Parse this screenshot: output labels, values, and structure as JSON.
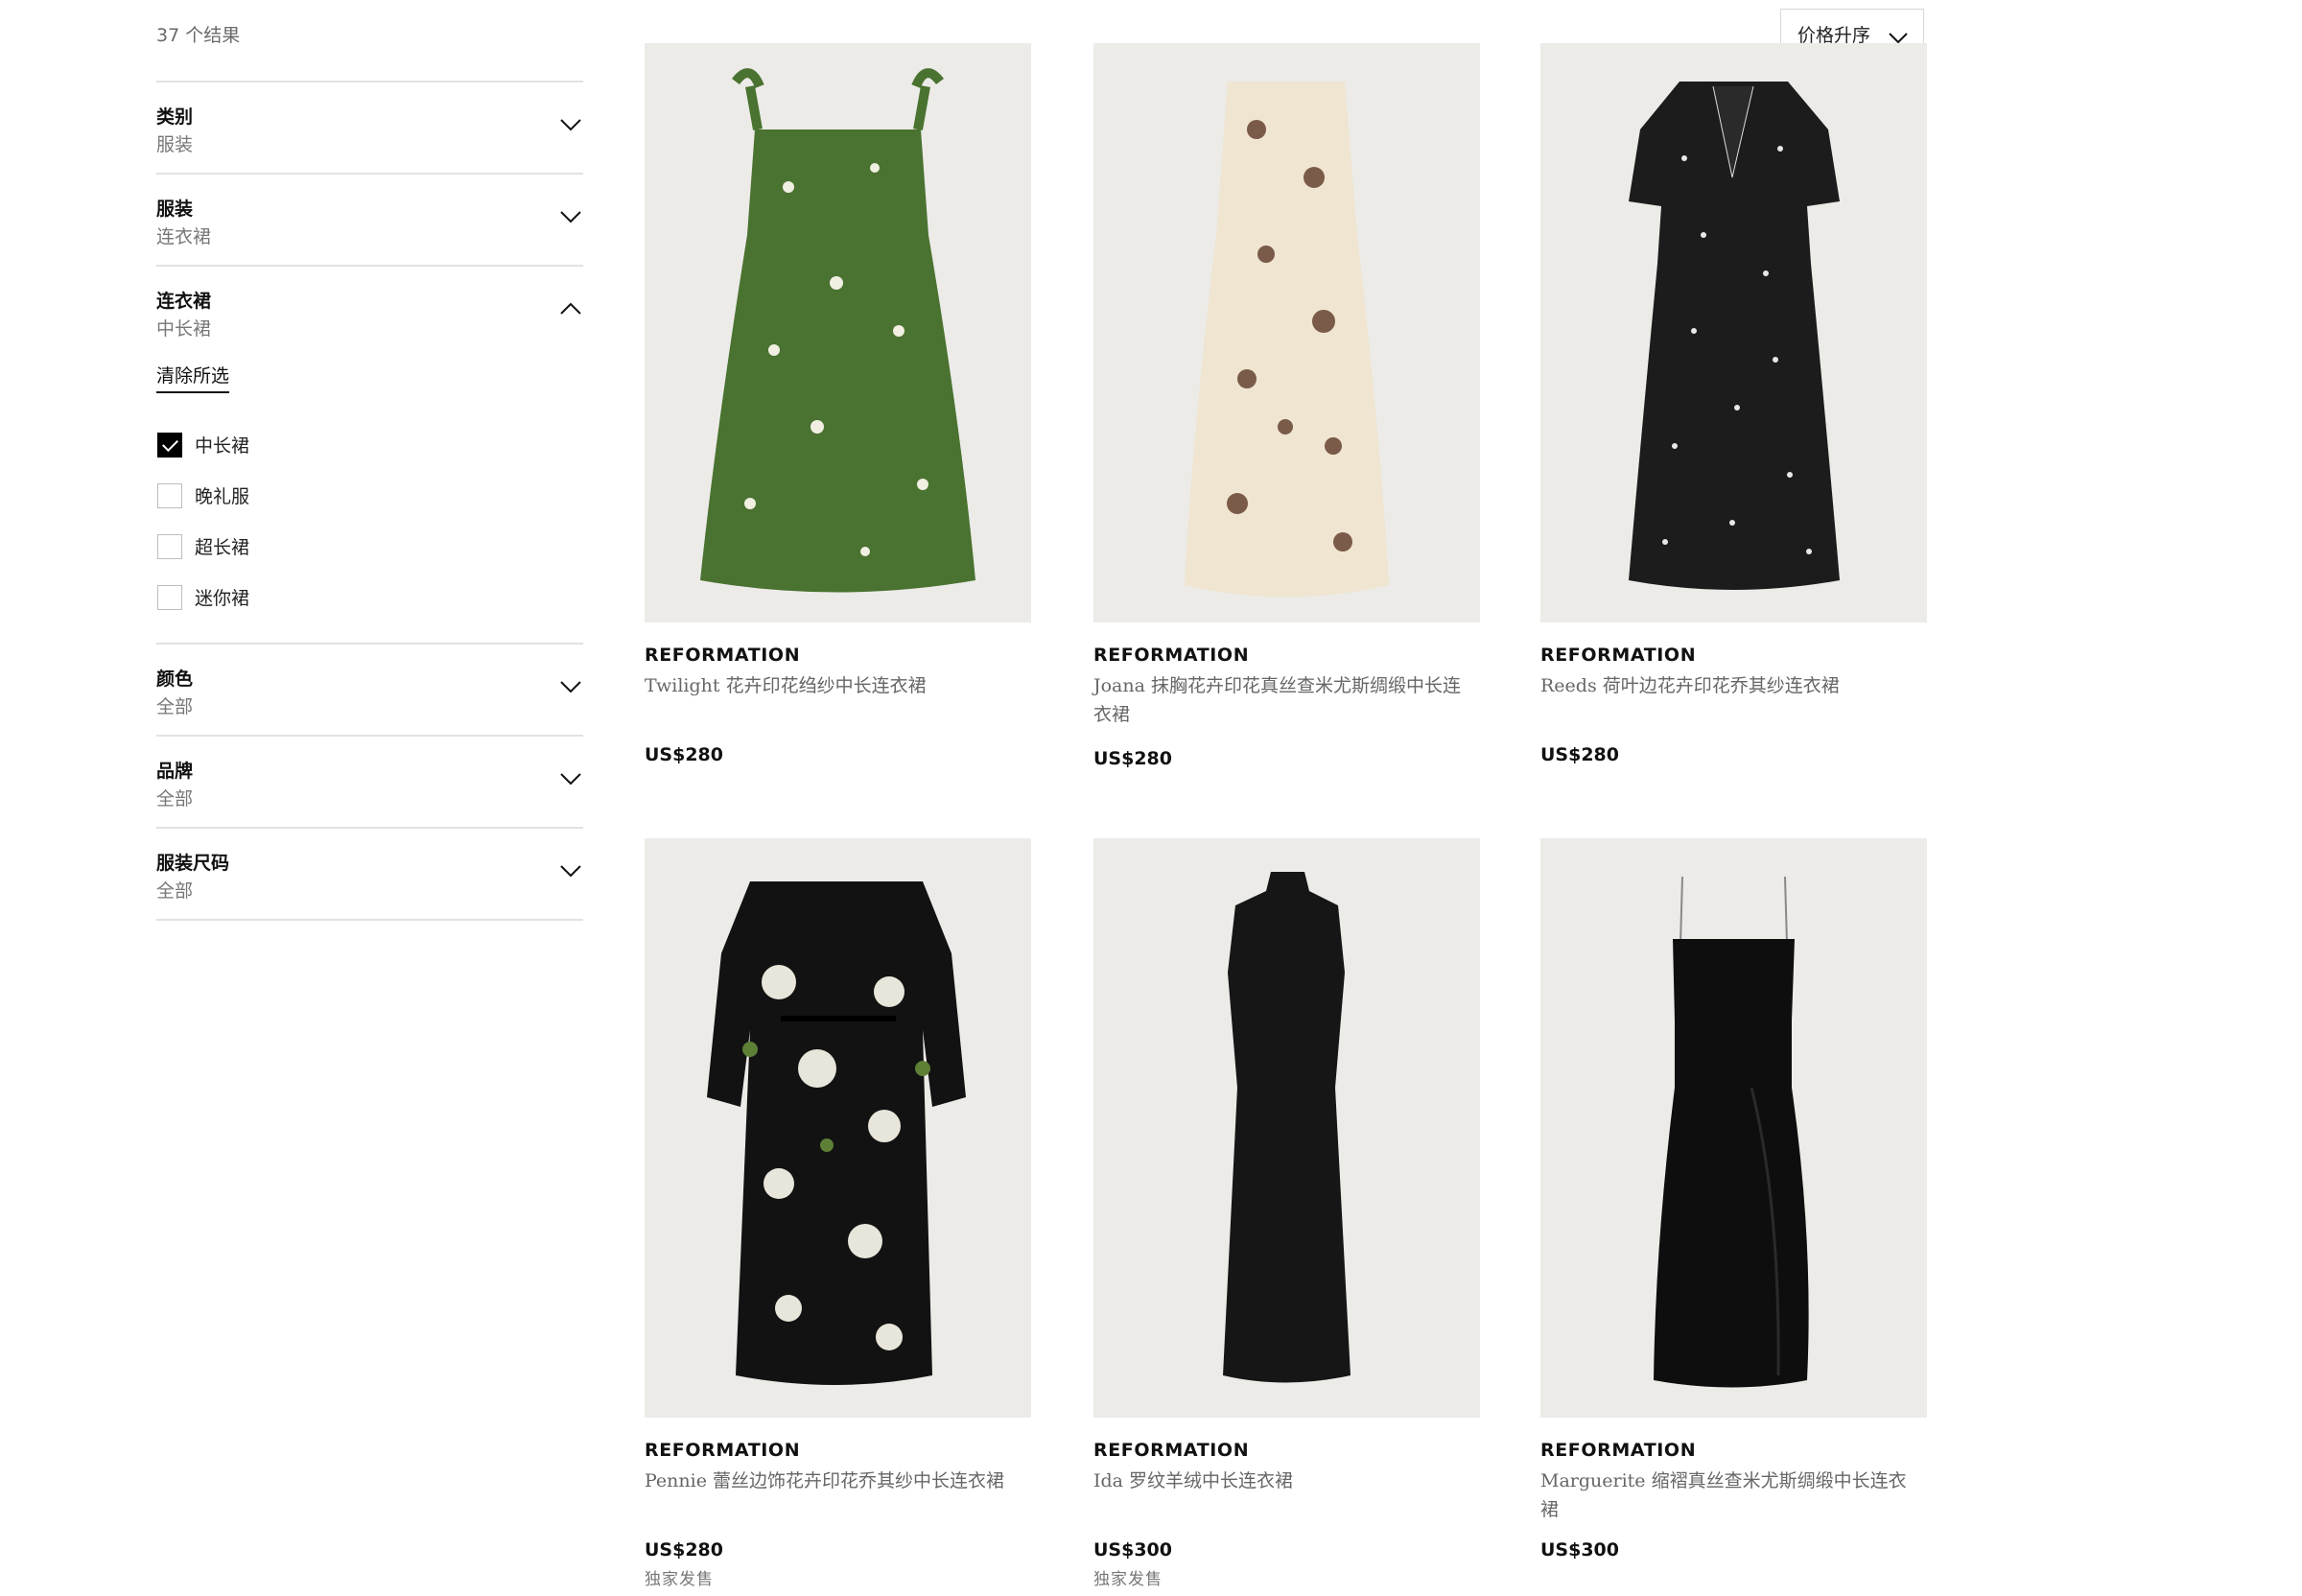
{
  "results": {
    "count_label": "37 个结果"
  },
  "sort": {
    "label": "价格升序"
  },
  "filters": {
    "category": {
      "title": "类别",
      "value": "服装"
    },
    "clothing": {
      "title": "服装",
      "value": "连衣裙"
    },
    "dresses": {
      "title": "连衣裙",
      "value": "中长裙",
      "clear_label": "清除所选",
      "options": [
        {
          "label": "中长裙",
          "checked": true
        },
        {
          "label": "晚礼服",
          "checked": false
        },
        {
          "label": "超长裙",
          "checked": false
        },
        {
          "label": "迷你裙",
          "checked": false
        }
      ]
    },
    "color": {
      "title": "颜色",
      "value": "全部"
    },
    "brand": {
      "title": "品牌",
      "value": "全部"
    },
    "size": {
      "title": "服装尺码",
      "value": "全部"
    }
  },
  "products": [
    {
      "brand": "REFORMATION",
      "name": "Twilight 花卉印花绉纱中长连衣裙",
      "price": "US$280",
      "badge": "",
      "image_colors": {
        "main": "#4a7230",
        "print": "#f1efe2"
      }
    },
    {
      "brand": "REFORMATION",
      "name": "Joana 抹胸花卉印花真丝查米尤斯绸缎中长连衣裙",
      "price": "US$280",
      "badge": "",
      "image_colors": {
        "main": "#efe5d0",
        "print": "#7a5a48"
      }
    },
    {
      "brand": "REFORMATION",
      "name": "Reeds 荷叶边花卉印花乔其纱连衣裙",
      "price": "US$280",
      "badge": "",
      "image_colors": {
        "main": "#1c1c1c",
        "print": "#e8e8e8"
      }
    },
    {
      "brand": "REFORMATION",
      "name": "Pennie 蕾丝边饰花卉印花乔其纱中长连衣裙",
      "price": "US$280",
      "badge": "独家发售",
      "image_colors": {
        "main": "#121212",
        "print": "#e8e6da"
      }
    },
    {
      "brand": "REFORMATION",
      "name": "Ida 罗纹羊绒中长连衣裙",
      "price": "US$300",
      "badge": "独家发售",
      "image_colors": {
        "main": "#161616",
        "print": ""
      }
    },
    {
      "brand": "REFORMATION",
      "name": "Marguerite 缩褶真丝查米尤斯绸缎中长连衣裙",
      "price": "US$300",
      "badge": "",
      "image_colors": {
        "main": "#0e0e0e",
        "print": ""
      }
    }
  ]
}
